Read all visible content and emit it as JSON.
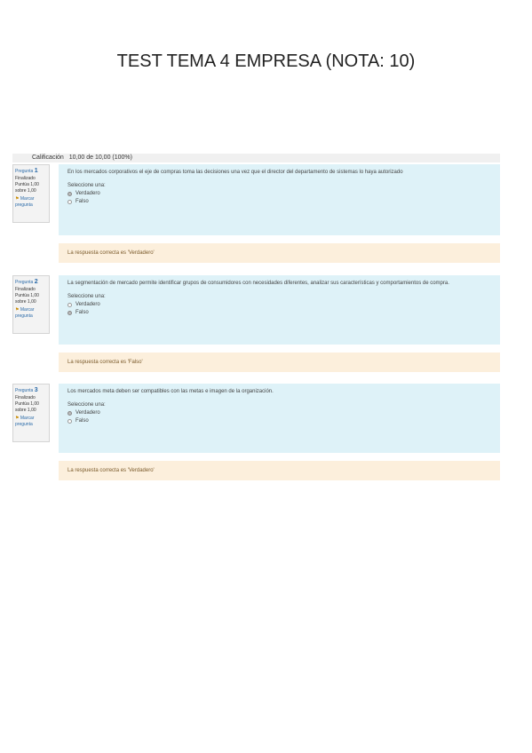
{
  "document": {
    "title": "TEST TEMA 4 EMPRESA (NOTA: 10)"
  },
  "grade": {
    "label": "Calificación",
    "value": "10,00 de 10,00 (100%)"
  },
  "questions": [
    {
      "number_label": "Pregunta",
      "number": "1",
      "state": "Finalizado",
      "score": "Puntúa 1,00 sobre 1,00",
      "flag_label": "Marcar pregunta",
      "text": "En los mercados corporativos el eje de compras toma las decisiones una vez que el director del departamento de sistemas lo haya autorizado",
      "prompt": "Seleccione una:",
      "options": [
        {
          "label": "Verdadero",
          "selected": true
        },
        {
          "label": "Falso",
          "selected": false
        }
      ],
      "feedback": "La respuesta correcta es 'Verdadero'"
    },
    {
      "number_label": "Pregunta",
      "number": "2",
      "state": "Finalizado",
      "score": "Puntúa 1,00 sobre 1,00",
      "flag_label": "Marcar pregunta",
      "text": "La segmentación de mercado permite identificar grupos de consumidores con necesidades diferentes, analizar sus características y comportamientos de compra.",
      "prompt": "Seleccione una:",
      "options": [
        {
          "label": "Verdadero",
          "selected": false
        },
        {
          "label": "Falso",
          "selected": true
        }
      ],
      "feedback": "La respuesta correcta es 'Falso'"
    },
    {
      "number_label": "Pregunta",
      "number": "3",
      "state": "Finalizado",
      "score": "Puntúa 1,00 sobre 1,00",
      "flag_label": "Marcar pregunta",
      "text": "Los mercados meta deben ser compatibles con las metas e imagen de la organización.",
      "prompt": "Seleccione una:",
      "options": [
        {
          "label": "Verdadero",
          "selected": true
        },
        {
          "label": "Falso",
          "selected": false
        }
      ],
      "feedback": "La respuesta correcta es 'Verdadero'"
    }
  ]
}
